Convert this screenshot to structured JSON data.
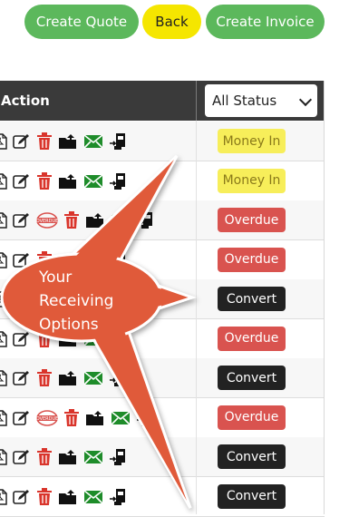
{
  "toolbar": {
    "create_quote": "Create Quote",
    "back": "Back",
    "create_invoice": "Create Invoice"
  },
  "table": {
    "action_header": "Action",
    "status_filter": "All Status",
    "rows": [
      {
        "status": "Money In",
        "status_kind": "money",
        "overdue_stamp": false
      },
      {
        "status": "Money In",
        "status_kind": "money",
        "overdue_stamp": false
      },
      {
        "status": "Overdue",
        "status_kind": "overdue",
        "overdue_stamp": true
      },
      {
        "status": "Overdue",
        "status_kind": "overdue",
        "overdue_stamp": false
      },
      {
        "status": "Convert",
        "status_kind": "convert",
        "overdue_stamp": false
      },
      {
        "status": "Overdue",
        "status_kind": "overdue",
        "overdue_stamp": false
      },
      {
        "status": "Convert",
        "status_kind": "convert",
        "overdue_stamp": false
      },
      {
        "status": "Overdue",
        "status_kind": "overdue",
        "overdue_stamp": true
      },
      {
        "status": "Convert",
        "status_kind": "convert",
        "overdue_stamp": false
      },
      {
        "status": "Convert",
        "status_kind": "convert",
        "overdue_stamp": false
      }
    ]
  },
  "callout": {
    "line1": "Your",
    "line2": "Receiving",
    "line3": "Options",
    "color": "#e05a3a"
  },
  "colors": {
    "green": "#5cb85c",
    "yellow": "#f5e600",
    "header_bg": "#3a3a3a",
    "overdue": "#d9534f",
    "money_in": "#f7ee5a",
    "convert": "#222222"
  },
  "icons": [
    "pdf-icon",
    "edit-icon",
    "overdue-stamp-icon",
    "trash-icon",
    "folder-upload-icon",
    "email-icon",
    "receive-payment-icon"
  ]
}
